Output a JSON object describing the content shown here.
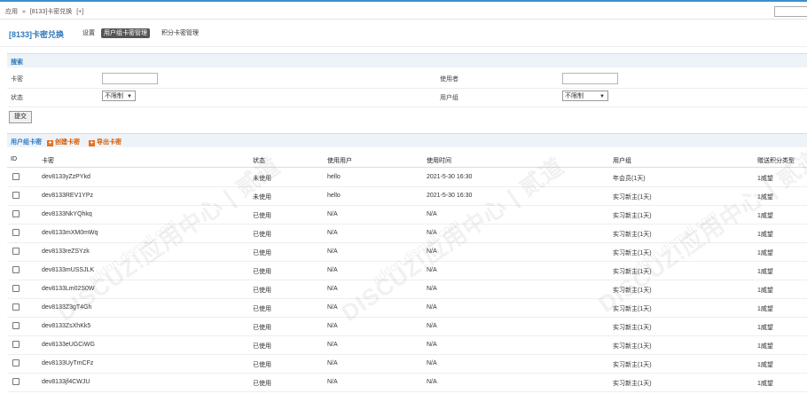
{
  "breadcrumb": [
    "应用",
    "»",
    "[8133]卡密兑换",
    "[+]"
  ],
  "plugin": {
    "title": "[8133]卡密兑换",
    "tabs": [
      "设置",
      "用户组卡密管理",
      "积分卡密管理"
    ]
  },
  "search": {
    "heading": "搜索",
    "card_label": "卡密",
    "user_label": "使用者",
    "status_label": "状态",
    "status_value": "不限制",
    "group_label": "用户组",
    "group_value": "不限制",
    "submit": "提交"
  },
  "cards": {
    "heading": "用户组卡密",
    "create": "创建卡密",
    "export": "导出卡密",
    "columns": [
      "ID",
      "卡密",
      "状态",
      "使用用户",
      "使用时间",
      "用户组",
      "赠送积分类型"
    ],
    "rows": [
      {
        "card": "dev8133yZzPYkd",
        "status": "未使用",
        "user": "hello",
        "time": "2021-5-30 16:30",
        "group": "年会员(1天)",
        "ext": "1威望"
      },
      {
        "card": "dev8133REV1YPz",
        "status": "未使用",
        "user": "hello",
        "time": "2021-5-30 16:30",
        "group": "实习新主(1天)",
        "ext": "1威望"
      },
      {
        "card": "dev8133NkYQhkq",
        "status": "已使用",
        "user": "N/A",
        "time": "N/A",
        "group": "实习新主(1天)",
        "ext": "1威望"
      },
      {
        "card": "dev8133mXM0mWq",
        "status": "已使用",
        "user": "N/A",
        "time": "N/A",
        "group": "实习新主(1天)",
        "ext": "1威望"
      },
      {
        "card": "dev8133reZSYzk",
        "status": "已使用",
        "user": "N/A",
        "time": "N/A",
        "group": "实习新主(1天)",
        "ext": "1威望"
      },
      {
        "card": "dev8133mUSSJLK",
        "status": "已使用",
        "user": "N/A",
        "time": "N/A",
        "group": "实习新主(1天)",
        "ext": "1威望"
      },
      {
        "card": "dev8133Lm02S0W",
        "status": "已使用",
        "user": "N/A",
        "time": "N/A",
        "group": "实习新主(1天)",
        "ext": "1威望"
      },
      {
        "card": "dev8133Z3gT4Gh",
        "status": "已使用",
        "user": "N/A",
        "time": "N/A",
        "group": "实习新主(1天)",
        "ext": "1威望"
      },
      {
        "card": "dev8133ZsXhKk5",
        "status": "已使用",
        "user": "N/A",
        "time": "N/A",
        "group": "实习新主(1天)",
        "ext": "1威望"
      },
      {
        "card": "dev8133eUGCiWG",
        "status": "已使用",
        "user": "N/A",
        "time": "N/A",
        "group": "实习新主(1天)",
        "ext": "1威望"
      },
      {
        "card": "dev8133UyTmCFz",
        "status": "已使用",
        "user": "N/A",
        "time": "N/A",
        "group": "实习新主(1天)",
        "ext": "1威望"
      },
      {
        "card": "dev8133jf4CWJU",
        "status": "已使用",
        "user": "N/A",
        "time": "N/A",
        "group": "实习新主(1天)",
        "ext": "1威望"
      }
    ]
  },
  "watermark": {
    "main": "DISCUZ!应用中心 | 贰道",
    "sub": "addon.dismall.com"
  },
  "colors": {
    "accent": "#2e77b8",
    "action": "#d45a00",
    "header_bg": "#eef3f8"
  }
}
